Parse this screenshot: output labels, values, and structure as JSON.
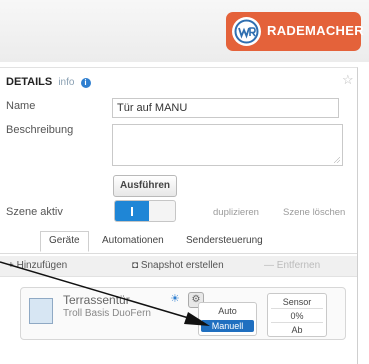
{
  "brand": {
    "name": "RADEMACHER"
  },
  "details": {
    "title": "DETAILS",
    "info_label": "info",
    "info_icon": "info-icon",
    "star_icon": "star-icon"
  },
  "form": {
    "name_label": "Name",
    "name_value": "Tür auf MANU",
    "description_label": "Beschreibung",
    "run_button": "Ausführen",
    "scene_active_label": "Szene aktiv",
    "duplicate_link": "duplizieren",
    "delete_link": "Szene löschen"
  },
  "tabs": [
    {
      "label": "Geräte",
      "active": true
    },
    {
      "label": "Automationen",
      "active": false
    },
    {
      "label": "Sendersteuerung",
      "active": false
    }
  ],
  "toolbar": {
    "add": "+ Hinzufügen",
    "snapshot": "Snapshot erstellen",
    "remove": "— Entfernen"
  },
  "device": {
    "name": "Terrassentür",
    "type": "Troll Basis DuoFern",
    "mode_auto": "Auto",
    "mode_manual": "Manuell",
    "sensor": "Sensor",
    "position": "0%",
    "action": "Ab"
  },
  "colors": {
    "brand": "#e4623a",
    "accent": "#1f86d6"
  }
}
